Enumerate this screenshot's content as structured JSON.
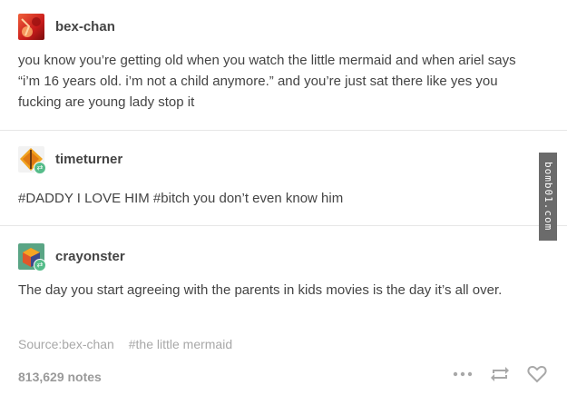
{
  "posts": [
    {
      "username": "bex-chan",
      "text": "you know you’re getting old when you watch the little mermaid and when ariel says “i’m 16 years old. i’m not a child anymore.” and you’re just sat there like yes you fucking are young lady stop it",
      "avatar_icon": "bex-chan-avatar"
    },
    {
      "username": "timeturner",
      "text": "#DADDY I LOVE HIM #bitch you don’t even know him",
      "avatar_icon": "timeturner-avatar"
    },
    {
      "username": "crayonster",
      "text": "The day you start agreeing with the parents in kids movies is the day it’s all over.",
      "avatar_icon": "crayonster-avatar"
    }
  ],
  "footer": {
    "source": "Source:bex-chan",
    "tag": "#the little mermaid",
    "notes": "813,629 notes"
  },
  "watermark": "bomb01.com",
  "colors": {
    "reblog_green": "#56bc8a",
    "text": "#444444",
    "muted": "#a8a8a8"
  }
}
